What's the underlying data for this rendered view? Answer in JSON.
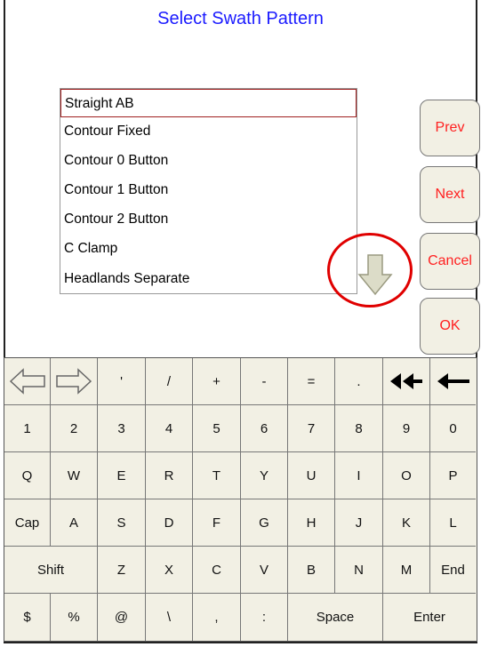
{
  "dialog": {
    "title": "Select Swath Pattern"
  },
  "patterns": {
    "items": [
      {
        "label": "Straight AB",
        "selected": true
      },
      {
        "label": "Contour Fixed",
        "selected": false
      },
      {
        "label": "Contour 0 Button",
        "selected": false
      },
      {
        "label": "Contour 1 Button",
        "selected": false
      },
      {
        "label": "Contour 2 Button",
        "selected": false
      },
      {
        "label": "C Clamp",
        "selected": false
      },
      {
        "label": "Headlands Separate",
        "selected": false
      }
    ]
  },
  "side_buttons": {
    "prev": "Prev",
    "next": "Next",
    "cancel": "Cancel",
    "ok": "OK"
  },
  "keyboard": {
    "row0": [
      "",
      "",
      "'",
      "/",
      "+",
      "-",
      "=",
      ".",
      "",
      ""
    ],
    "row0_icons": [
      "left-outline-arrow-icon",
      "right-outline-arrow-icon",
      "",
      "",
      "",
      "",
      "",
      "",
      "double-back-arrow-icon",
      "backspace-arrow-icon"
    ],
    "row1": [
      "1",
      "2",
      "3",
      "4",
      "5",
      "6",
      "7",
      "8",
      "9",
      "0"
    ],
    "row2": [
      "Q",
      "W",
      "E",
      "R",
      "T",
      "Y",
      "U",
      "I",
      "O",
      "P"
    ],
    "row3": [
      "Cap",
      "A",
      "S",
      "D",
      "F",
      "G",
      "H",
      "J",
      "K",
      "L"
    ],
    "row4": [
      "Shift",
      "Z",
      "X",
      "C",
      "V",
      "B",
      "N",
      "M",
      "End"
    ],
    "row5": [
      "$",
      "%",
      "@",
      "\\",
      ",",
      ":",
      "Space",
      "Enter"
    ]
  },
  "colors": {
    "title": "#1a1aff",
    "button_text": "#ff2020",
    "key_bg": "#f2f0e4",
    "highlight": "#e00000"
  }
}
